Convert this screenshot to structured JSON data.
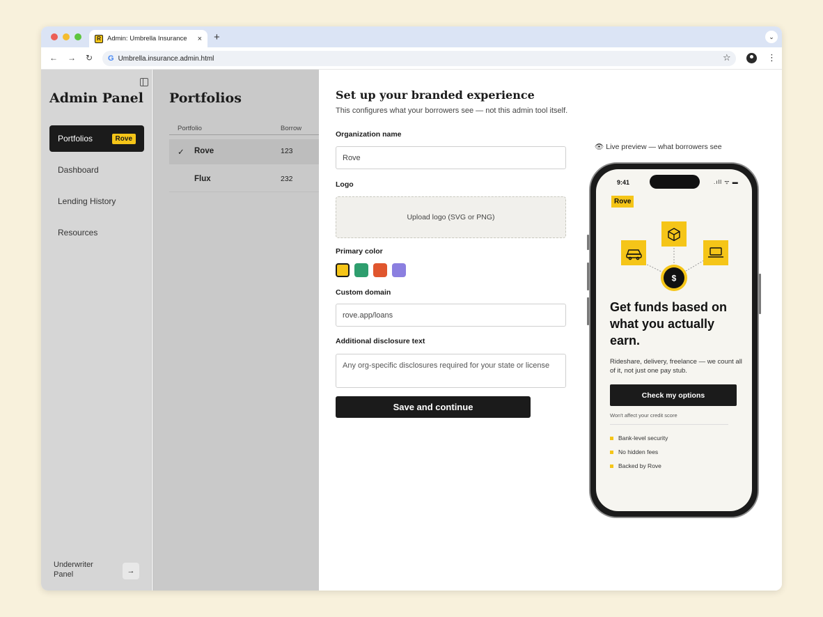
{
  "browser": {
    "tab_title": "Admin: Umbrella Insurance",
    "tab_favicon_letter": "R",
    "tab_close": "×",
    "new_tab": "+",
    "url": "Umbrella.insurance.admin.html",
    "traffic_lights": [
      "#ec5f56",
      "#f4bc2f",
      "#5ec53f"
    ]
  },
  "sidebar": {
    "title": "Admin Panel",
    "items": [
      {
        "label": "Portfolios",
        "badge": "Rove",
        "active": true
      },
      {
        "label": "Dashboard"
      },
      {
        "label": "Lending History"
      },
      {
        "label": "Resources"
      }
    ],
    "footer_label": "Underwriter Panel",
    "footer_button": "→"
  },
  "portfolios": {
    "title": "Portfolios",
    "columns": [
      "Portfolio",
      "Borrow"
    ],
    "rows": [
      {
        "check": "✓",
        "name": "Rove",
        "count": "123",
        "selected": true
      },
      {
        "check": "",
        "name": "Flux",
        "count": "232",
        "selected": false
      }
    ]
  },
  "setup": {
    "title": "Set up your branded experience",
    "subtitle": "This configures what your borrowers see — not this admin tool itself.",
    "org_label": "Organization name",
    "org_value": "Rove",
    "logo_label": "Logo",
    "upload_text": "Upload logo (SVG or PNG)",
    "color_label": "Primary color",
    "colors": [
      "#f5c518",
      "#2e9e6e",
      "#e0562e",
      "#8b7fe0"
    ],
    "selected_color": 0,
    "domain_label": "Custom domain",
    "domain_value": "rove.app/loans",
    "disclosure_label": "Additional disclosure text",
    "disclosure_placeholder": "Any org-specific disclosures required for your state or license",
    "save_label": "Save and continue"
  },
  "preview": {
    "label": "👁 Live preview — what borrowers see",
    "time": "9:41",
    "status": ".ıll ᯤ ▬",
    "brand": "Rove",
    "headline": "Get funds based on what you actually earn.",
    "body": "Rideshare, delivery, freelance — we count all of it, not just one pay stub.",
    "cta": "Check my options",
    "note": "Won't affect your credit score",
    "hero_center": "$",
    "bullets": [
      "Bank-level security",
      "No hidden fees",
      "Backed by Rove"
    ]
  }
}
